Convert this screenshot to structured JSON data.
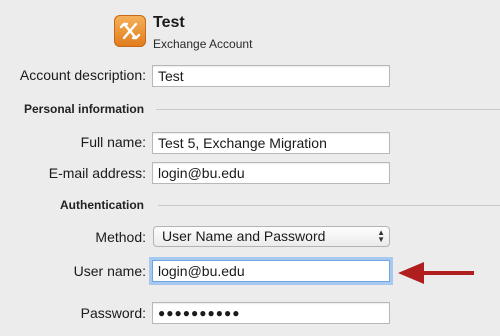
{
  "account": {
    "name": "Test",
    "type": "Exchange Account",
    "icon": "exchange-icon"
  },
  "description": {
    "label": "Account description:",
    "value": "Test"
  },
  "personal": {
    "heading": "Personal information",
    "full_name_label": "Full name:",
    "full_name_value": "Test 5, Exchange Migration",
    "email_label": "E-mail address:",
    "email_value": "login@bu.edu"
  },
  "auth": {
    "heading": "Authentication",
    "method_label": "Method:",
    "method_value": "User Name and Password",
    "username_label": "User name:",
    "username_value": "login@bu.edu",
    "password_label": "Password:",
    "password_value": "●●●●●●●●●●"
  },
  "colors": {
    "annotation_arrow": "#b01e1e",
    "focus_ring": "#a7c9f0",
    "window_bg": "#ececec"
  }
}
